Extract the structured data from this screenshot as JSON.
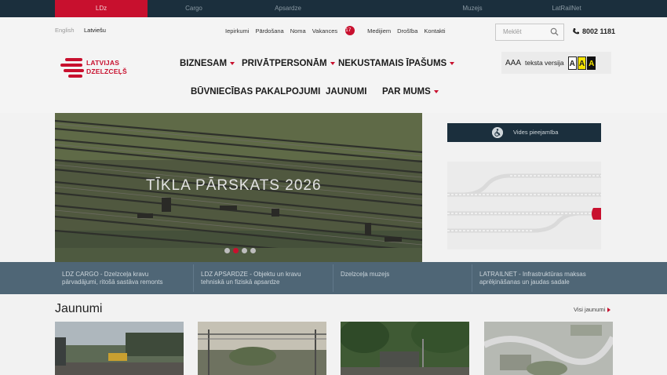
{
  "topbar": {
    "tabs": [
      {
        "label": "LDz",
        "active": true
      },
      {
        "label": "Cargo",
        "active": false
      },
      {
        "label": "Apsardze",
        "active": false
      },
      {
        "label": "Muzejs",
        "active": false
      },
      {
        "label": "LatRailNet",
        "active": false
      }
    ]
  },
  "header": {
    "languages": [
      "English",
      "Latviešu"
    ],
    "utility_links": [
      "Iepirkumi",
      "Pārdošana",
      "Noma",
      "Vakances",
      "Medijiem",
      "Drošība",
      "Kontakti"
    ],
    "vacancies_count": "17",
    "search_placeholder": "Meklēt",
    "phone": "8002 1181",
    "logo_line1": "LATVIJAS",
    "logo_line2": "DZELZCEĻŠ",
    "nav": [
      "BIZNESAM",
      "PRIVĀTPERSONĀM",
      "NEKUSTAMAIS ĪPAŠUMS",
      "BŪVNIECĪBAS PAKALPOJUMI",
      "JAUNUMI",
      "PAR MUMS"
    ],
    "text_version": {
      "sizes": "AAA",
      "label": "teksta versija",
      "contrast": [
        "A",
        "A",
        "A"
      ]
    }
  },
  "hero": {
    "title": "TĪKLA PĀRSKATS 2026",
    "slides": 4,
    "active_slide": 2
  },
  "sidebar": {
    "accessibility_button": "Vides pieejamība"
  },
  "strip": [
    {
      "line1": "LDZ CARGO - Dzelzceļa kravu",
      "line2": "pārvadājumi, ritošā sastāva remonts"
    },
    {
      "line1": "LDZ APSARDZE - Objektu un kravu",
      "line2": "tehniskā un fiziskā apsardze"
    },
    {
      "line1": "Dzelzceļa muzejs",
      "line2": ""
    },
    {
      "line1": "LATRAILNET - Infrastruktūras maksas",
      "line2": "aprēķināšanas un jaudas sadale"
    }
  ],
  "news": {
    "heading": "Jaunumi",
    "all_link": "Visi jaunumi"
  },
  "colors": {
    "brand_red": "#c8102e",
    "dark_navy": "#1b2f3d",
    "strip": "#4f6676"
  }
}
